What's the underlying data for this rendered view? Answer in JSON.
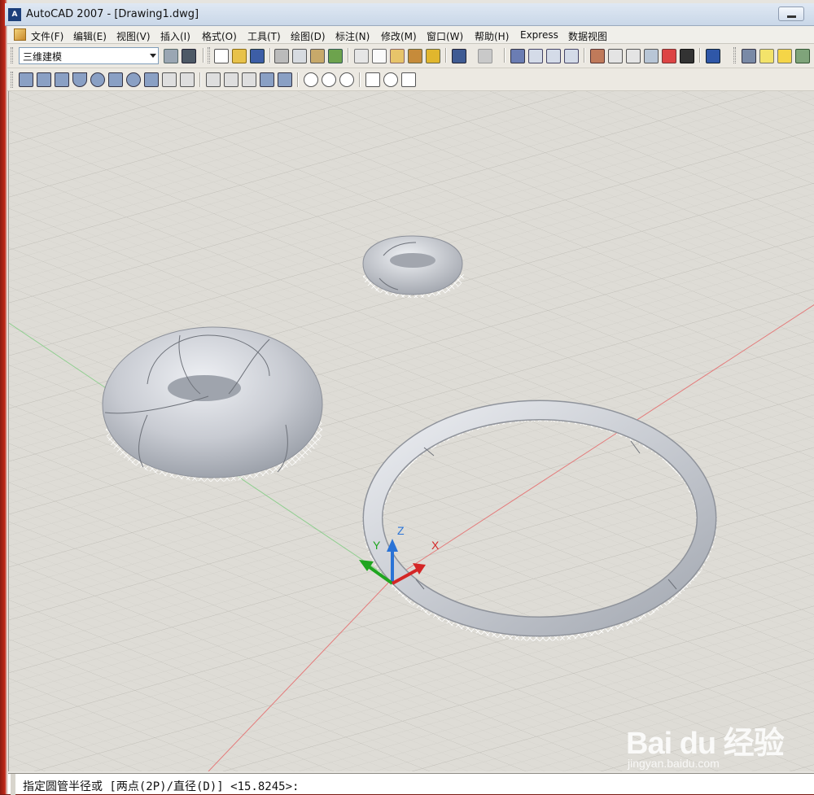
{
  "window": {
    "title": "AutoCAD 2007 - [Drawing1.dwg]"
  },
  "menu": [
    "文件(F)",
    "编辑(E)",
    "视图(V)",
    "插入(I)",
    "格式(O)",
    "工具(T)",
    "绘图(D)",
    "标注(N)",
    "修改(M)",
    "窗口(W)",
    "帮助(H)",
    "Express",
    "数据视图"
  ],
  "toolbar": {
    "workspace": "三维建模"
  },
  "viewport": {
    "ucs": {
      "x_label": "X",
      "y_label": "Y",
      "z_label": "Z"
    }
  },
  "command_line": {
    "prompt": "指定圆管半径或 [两点(2P)/直径(D)] <15.8245>:"
  },
  "watermark": {
    "logo": "Bai du 经验",
    "url": "jingyan.baidu.com"
  }
}
